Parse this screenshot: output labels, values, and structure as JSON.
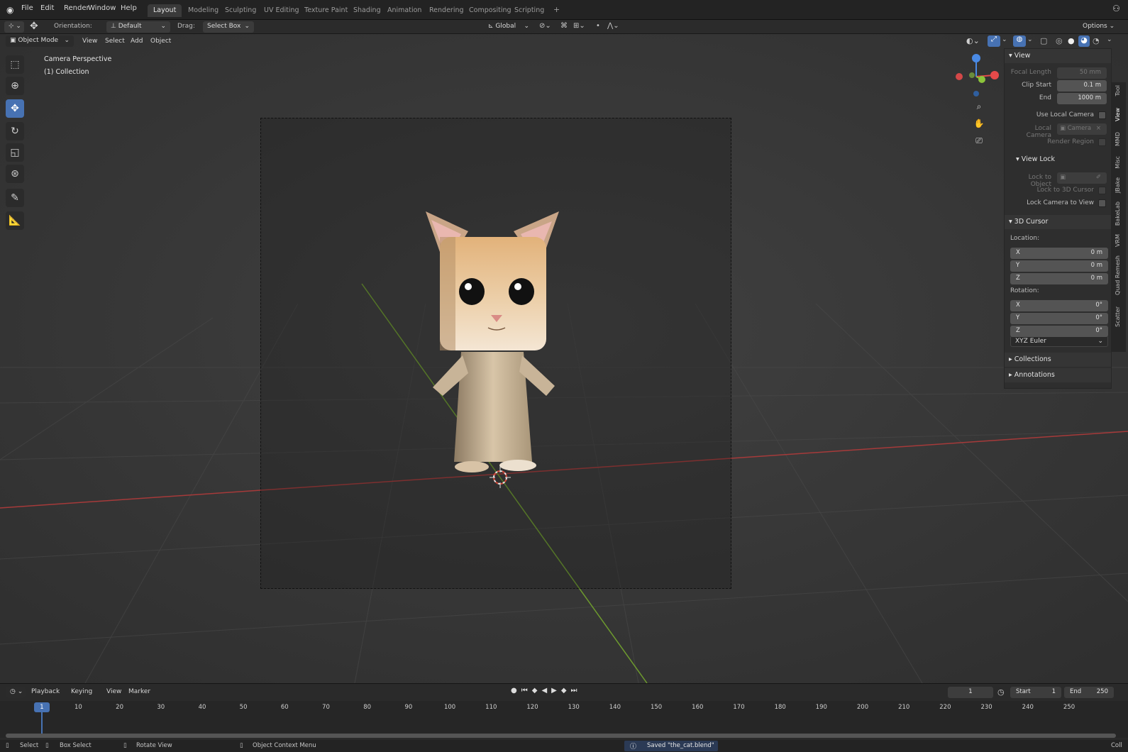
{
  "menus": [
    "File",
    "Edit",
    "Render",
    "Window",
    "Help"
  ],
  "workspaces": [
    "Layout",
    "Modeling",
    "Sculpting",
    "UV Editing",
    "Texture Paint",
    "Shading",
    "Animation",
    "Rendering",
    "Compositing",
    "Scripting"
  ],
  "active_workspace": "Layout",
  "add_workspace": "+",
  "tool_header": {
    "orientation_label": "Orientation:",
    "orientation_value": "Default",
    "drag_label": "Drag:",
    "drag_value": "Select Box",
    "transform_orientation": "Global",
    "options": "Options"
  },
  "viewport_header": {
    "mode": "Object Mode",
    "menus": [
      "View",
      "Select",
      "Add",
      "Object"
    ]
  },
  "viewport": {
    "overlay_title": "Camera Perspective",
    "overlay_collection": "(1) Collection"
  },
  "npanel": {
    "view": {
      "title": "View",
      "focal_length_label": "Focal Length",
      "focal_length": "50 mm",
      "clip_start_label": "Clip Start",
      "clip_start": "0.1 m",
      "end_label": "End",
      "end": "1000 m",
      "use_local_camera": "Use Local Camera",
      "local_camera_label": "Local Camera",
      "local_camera_value": "Camera",
      "render_region": "Render Region"
    },
    "view_lock": {
      "title": "View Lock",
      "lock_to_object": "Lock to Object",
      "lock_to_3d_cursor": "Lock to 3D Cursor",
      "lock_camera_to_view": "Lock Camera to View"
    },
    "cursor": {
      "title": "3D Cursor",
      "location_label": "Location:",
      "location": [
        {
          "axis": "X",
          "value": "0 m"
        },
        {
          "axis": "Y",
          "value": "0 m"
        },
        {
          "axis": "Z",
          "value": "0 m"
        }
      ],
      "rotation_label": "Rotation:",
      "rotation": [
        {
          "axis": "X",
          "value": "0°"
        },
        {
          "axis": "Y",
          "value": "0°"
        },
        {
          "axis": "Z",
          "value": "0°"
        }
      ],
      "rotation_mode": "XYZ Euler"
    },
    "collections": "Collections",
    "annotations": "Annotations"
  },
  "side_tabs": [
    "Tool",
    "View",
    "MMD",
    "Misc",
    "JBake",
    "BakeLab",
    "VRM",
    "Quad Remesh",
    "Scatter"
  ],
  "timeline": {
    "menus": [
      "Playback",
      "Keying",
      "View",
      "Marker"
    ],
    "current_frame": "1",
    "start_label": "Start",
    "start": "1",
    "end_label": "End",
    "end": "250",
    "frame_marker": "1",
    "ticks": [
      "10",
      "20",
      "30",
      "40",
      "50",
      "60",
      "70",
      "80",
      "90",
      "100",
      "110",
      "120",
      "130",
      "140",
      "150",
      "160",
      "170",
      "180",
      "190",
      "200",
      "210",
      "220",
      "230",
      "240",
      "250"
    ]
  },
  "statusbar": {
    "select": "Select",
    "box_select": "Box Select",
    "rotate_view": "Rotate View",
    "context_menu": "Object Context Menu",
    "message": "Saved \"the_cat.blend\"",
    "right_text": "Coll"
  },
  "colors": {
    "accent": "#4772b3",
    "x_axis": "#e54a4a",
    "y_axis": "#8cc43b",
    "z_axis": "#4a8ae5"
  }
}
